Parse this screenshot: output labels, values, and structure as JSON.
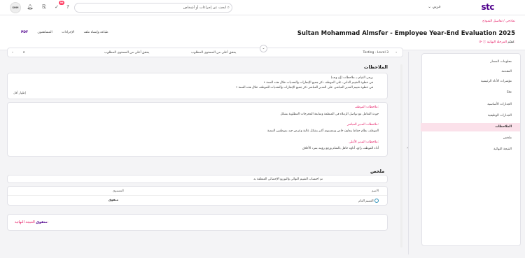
{
  "topbar": {
    "logo": "stc",
    "language": "عربي",
    "search_placeholder": "ابحث عن إجراءات أو أشخاص",
    "notifications_badge": "99",
    "avatar_initials": "SHM"
  },
  "header": {
    "breadcrumb": "نماذجي / تفاصيل النموذج",
    "title": "Sultan Mohammad Almsfer - Employee Year-End Evaluation 2025",
    "phase_label": "المرحلة النهائية:",
    "phase_value": "مُقيّم",
    "actions": {
      "pdf": "PDF",
      "print": "طباعة وإنشاء ملف",
      "actions": "الإجراءات",
      "contributors": "المساهمون"
    }
  },
  "sidebar": {
    "items": [
      "معلومات المسار",
      "المقدمة",
      "مؤشرات الأداء الرئيسية",
      "Stc",
      "الجدارات الأساسية",
      "الجدارات الوظيفية",
      "الملاحظات",
      "ملخص",
      "النتيجة النهائية"
    ],
    "active_index": 6
  },
  "level_row": {
    "level": "Testing - Level 3",
    "opt1": "يحقق أعلى من المستوى المطلوب",
    "opt2": "يحقق أعلى من المستوى المطلوب",
    "extra": "٥"
  },
  "comments_section": {
    "title": "الملاحظات",
    "instructions": [
      "يرجى القيام بـ ملاحظات (إن وجد)",
      "في خطوة التقييم الذاتي، على الموظف ذكر جميع الإنجازات والتحديات خلال هذه السنة",
      "في خطوة تقييم المدير المباشر، على المدير المباشر ذكر جميع الإنجازات والتحديات للموظف خلال هذه السنة"
    ],
    "show_less": "إظهار أقل",
    "entries": [
      {
        "heading": "ملاحظات الموظف:",
        "body": "جودة التعامل مع تواصل الزملاء في المنظمة ومتابعة المخرجات المطلوبة بشكل"
      },
      {
        "heading": "ملاحظات المدير المباشر:",
        "body": "الموظف نظام حفاظ يتعاون خاص وبمستوى أكبر بشكل عالية وعرض جيد بموظفين التنمية"
      },
      {
        "heading": "ملاحظات المدير الأعلى:",
        "body": "أداء الموظف رائع، أداؤه حافل بالتمام ورفع رؤيته بمرد الأخلاق"
      }
    ]
  },
  "summary_section": {
    "title": "ملخص",
    "note": "تم احتساب التقييم النهائي والتوزيع الإحصائي المتعلقة به",
    "columns": [
      "الاسم",
      "المستوى"
    ],
    "rows": [
      {
        "name": "التقييم العام",
        "value": "متفوق"
      }
    ]
  },
  "final": {
    "label": "النتيجة النهائية:",
    "value": "متفوق"
  }
}
